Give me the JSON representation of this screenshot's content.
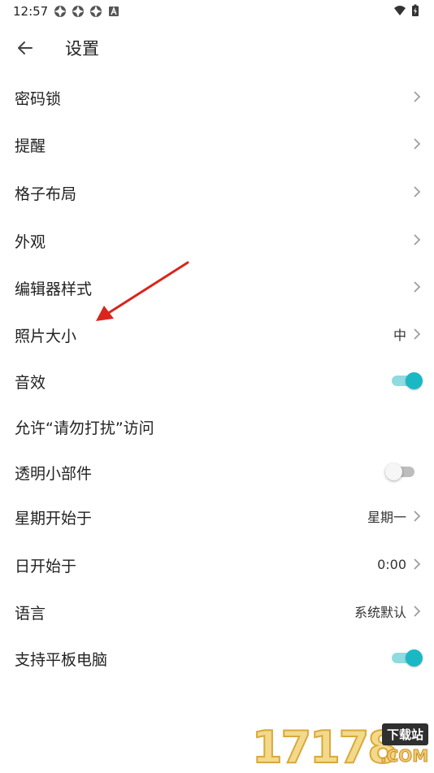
{
  "status_bar": {
    "time": "12:57",
    "left_icons": [
      "app-notification-icon",
      "app-notification-icon",
      "app-notification-icon",
      "a-badge-icon"
    ],
    "right_icons": [
      "wifi-icon",
      "battery-charging-icon"
    ]
  },
  "appbar": {
    "title": "设置",
    "back_icon": "arrow-left-icon"
  },
  "settings": {
    "passcode_lock": {
      "label": "密码锁"
    },
    "reminder": {
      "label": "提醒"
    },
    "grid_layout": {
      "label": "格子布局"
    },
    "appearance": {
      "label": "外观"
    },
    "editor_style": {
      "label": "编辑器样式"
    },
    "photo_size": {
      "label": "照片大小",
      "value": "中"
    },
    "sound_effects": {
      "label": "音效",
      "enabled": true
    },
    "dnd_access": {
      "label": "允许“请勿打扰”访问"
    },
    "transparent_widget": {
      "label": "透明小部件",
      "enabled": false
    },
    "week_start": {
      "label": "星期开始于",
      "value": "星期一"
    },
    "day_start": {
      "label": "日开始于",
      "value": "0:00"
    },
    "language": {
      "label": "语言",
      "value": "系统默认"
    },
    "tablet_support": {
      "label": "支持平板电脑",
      "enabled": true
    }
  },
  "watermark": {
    "number": "17178",
    "badge": "下载站",
    "domain": ".COM"
  },
  "colors": {
    "accent": "#1ab8c4",
    "accent_track": "#8fdbe0",
    "annotation_arrow": "#d9251d",
    "chevron": "#9e9e9e"
  }
}
